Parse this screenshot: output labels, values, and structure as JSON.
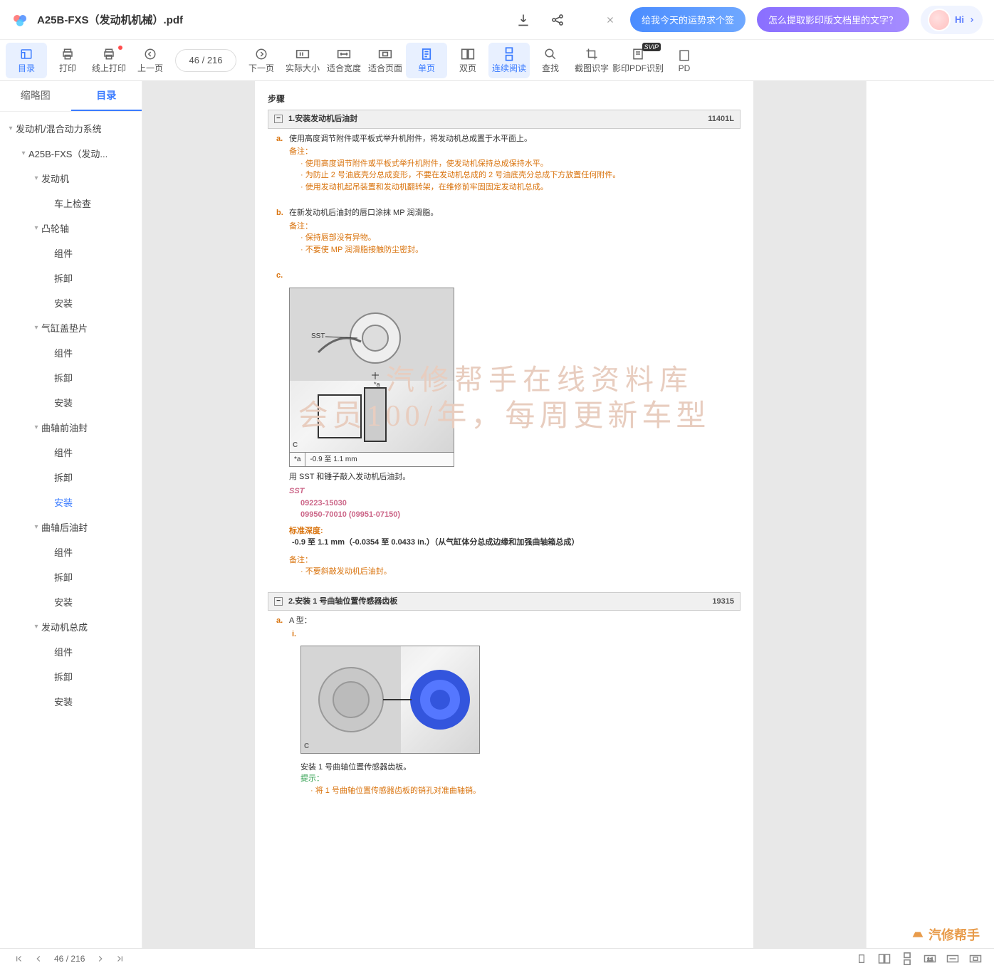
{
  "header": {
    "title": "A25B-FXS（发动机机械）.pdf",
    "pill1": "给我今天的运势求个签",
    "pill2": "怎么提取影印版文档里的文字？",
    "hi": "Hi"
  },
  "toolbar": {
    "toc": "目录",
    "print": "打印",
    "online_print": "线上打印",
    "prev": "上一页",
    "page_current": "46",
    "page_sep": "/",
    "page_total": "216",
    "next": "下一页",
    "actual": "实际大小",
    "fit_width": "适合宽度",
    "fit_page": "适合页面",
    "single": "单页",
    "double": "双页",
    "continuous": "连续阅读",
    "find": "查找",
    "ocr_img": "截图识字",
    "ocr_pdf": "影印PDF识别",
    "pdf_last": "PD",
    "svip": "SVIP"
  },
  "side_tabs": {
    "thumb": "缩略图",
    "toc": "目录"
  },
  "tree": [
    {
      "d": 0,
      "label": "发动机/混合动力系统",
      "exp": true
    },
    {
      "d": 1,
      "label": "A25B-FXS（发动...",
      "exp": true
    },
    {
      "d": 2,
      "label": "发动机",
      "exp": true
    },
    {
      "d": 3,
      "label": "车上检查"
    },
    {
      "d": 2,
      "label": "凸轮轴",
      "exp": true
    },
    {
      "d": 3,
      "label": "组件"
    },
    {
      "d": 3,
      "label": "拆卸"
    },
    {
      "d": 3,
      "label": "安装"
    },
    {
      "d": 2,
      "label": "气缸盖垫片",
      "exp": true
    },
    {
      "d": 3,
      "label": "组件"
    },
    {
      "d": 3,
      "label": "拆卸"
    },
    {
      "d": 3,
      "label": "安装"
    },
    {
      "d": 2,
      "label": "曲轴前油封",
      "exp": true
    },
    {
      "d": 3,
      "label": "组件"
    },
    {
      "d": 3,
      "label": "拆卸"
    },
    {
      "d": 3,
      "label": "安装",
      "sel": true
    },
    {
      "d": 2,
      "label": "曲轴后油封",
      "exp": true
    },
    {
      "d": 3,
      "label": "组件"
    },
    {
      "d": 3,
      "label": "拆卸"
    },
    {
      "d": 3,
      "label": "安装"
    },
    {
      "d": 2,
      "label": "发动机总成",
      "exp": true
    },
    {
      "d": 3,
      "label": "组件"
    },
    {
      "d": 3,
      "label": "拆卸"
    },
    {
      "d": 3,
      "label": "安装"
    }
  ],
  "doc": {
    "steps_title": "步骤",
    "step1": {
      "num": "1.",
      "title": "安装发动机后油封",
      "code": "11401L"
    },
    "a": {
      "lab": "a.",
      "txt": "使用高度调节附件或平板式举升机附件，将发动机总成置于水平面上。",
      "note": "备注：",
      "li1": "使用高度调节附件或平板式举升机附件，使发动机保持总成保持水平。",
      "li2": "为防止 2 号油底壳分总成变形，不要在发动机总成的 2 号油底壳分总成下方放置任何附件。",
      "li3": "使用发动机起吊装置和发动机翻转架，在维修前牢固固定发动机总成。"
    },
    "b": {
      "lab": "b.",
      "txt": "在新发动机后油封的唇口涂抹 MP 润滑脂。",
      "note": "备注：",
      "li1": "保持唇部没有异物。",
      "li2": "不要使 MP 润滑脂接触防尘密封。"
    },
    "c": {
      "lab": "c.",
      "sst_label": "SST",
      "fig_a": "*a",
      "fig_val": "-0.9 至 1.1 mm",
      "corner": "C",
      "caption": "用 SST 和锤子敲入发动机后油封。",
      "sst": "SST",
      "sst1": "09223-15030",
      "sst2": "09950-70010  (09951-07150)",
      "depth_label": "标准深度:",
      "depth_val": "-0.9 至 1.1 mm（-0.0354 至 0.0433 in.）（从气缸体分总成边缘和加强曲轴箱总成）",
      "note": "备注：",
      "note_li": "不要斜敲发动机后油封。"
    },
    "step2": {
      "num": "2.",
      "title": "安装 1 号曲轴位置传感器齿板",
      "code": "19315"
    },
    "a2": {
      "lab": "a.",
      "type": "A 型：",
      "i": "i.",
      "corner": "C",
      "caption": "安装 1 号曲轴位置传感器齿板。",
      "hint": "提示：",
      "hint_li": "将 1 号曲轴位置传感器齿板的销孔对准曲轴销。"
    },
    "wm1": "汽修帮手在线资料库",
    "wm2": "会员100/年，每周更新车型"
  },
  "footer": {
    "page_current": "46",
    "page_sep": "/",
    "page_total": "216"
  },
  "brand": "汽修帮手"
}
